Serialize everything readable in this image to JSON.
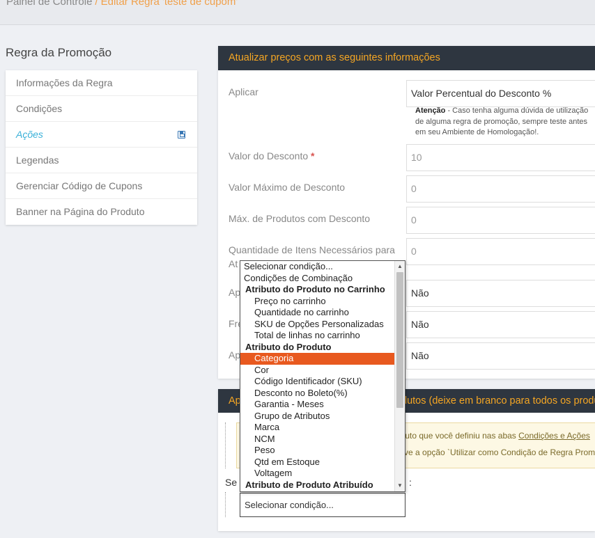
{
  "breadcrumb": {
    "root": "Painel de Controle",
    "separator": "/",
    "current": "Editar Regra 'teste de cupom'"
  },
  "sidebar": {
    "title": "Regra da Promoção",
    "items": [
      {
        "label": "Informações da Regra"
      },
      {
        "label": "Condições"
      },
      {
        "label": "Ações"
      },
      {
        "label": "Legendas"
      },
      {
        "label": "Gerenciar Código de Cupons"
      },
      {
        "label": "Banner na Página do Produto"
      }
    ]
  },
  "panel1": {
    "title": "Atualizar preços com as seguintes informações",
    "apply_label": "Aplicar",
    "apply_value": "Valor Percentual do Desconto %",
    "note_strong": "Atenção",
    "note_text": " - Caso tenha alguma dúvida de utilização de alguma regra de promoção, sempre teste antes em seu Ambiente de Homologação!.",
    "discount_label": "Valor do Desconto",
    "required_mark": "*",
    "discount_value": "10",
    "max_discount_label": "Valor Máximo de Desconto",
    "max_discount_value": "0",
    "max_products_label": "Máx. de Produtos com Desconto",
    "max_products_value": "0",
    "qty_label_line1": "Quantidade de Itens Necessários para",
    "qty_label_line2_prefix": "At",
    "qty_value": "0",
    "ap1_label_prefix": "Ap",
    "ap1_value": "Não",
    "fre_label_prefix": "Fre",
    "fre_value": "Não",
    "ap2_label_prefix": "Ap",
    "ap2_value": "Não"
  },
  "panel2": {
    "title_prefix": "Ap",
    "title_suffix": "dutos (deixe em branco para todos os produt",
    "info_line1": "oduto que você definiu nas abas ",
    "info_link": "Condições e Ações",
    "info_line2": "tive a opção `Utilizar como Condição de Regra Prom",
    "cond_prefix": "Se",
    "cond_suffix": ":",
    "cond_select_value": "Selecionar condição..."
  },
  "dropdown": {
    "options": [
      {
        "label": "Selecionar condição...",
        "kind": "top"
      },
      {
        "label": "Condições de Combinação",
        "kind": "top"
      },
      {
        "label": "Atributo do Produto no Carrinho",
        "kind": "group"
      },
      {
        "label": "Preço no carrinho",
        "kind": "child"
      },
      {
        "label": "Quantidade no carrinho",
        "kind": "child"
      },
      {
        "label": "SKU de Opções Personalizadas",
        "kind": "child"
      },
      {
        "label": "Total de linhas no carrinho",
        "kind": "child"
      },
      {
        "label": "Atributo do Produto",
        "kind": "group"
      },
      {
        "label": "Categoria",
        "kind": "child",
        "selected": true
      },
      {
        "label": "Cor",
        "kind": "child"
      },
      {
        "label": "Código Identificador (SKU)",
        "kind": "child"
      },
      {
        "label": "Desconto no Boleto(%)",
        "kind": "child"
      },
      {
        "label": "Garantia - Meses",
        "kind": "child"
      },
      {
        "label": "Grupo de Atributos",
        "kind": "child"
      },
      {
        "label": "Marca",
        "kind": "child"
      },
      {
        "label": "NCM",
        "kind": "child"
      },
      {
        "label": "Peso",
        "kind": "child"
      },
      {
        "label": "Qtd em Estoque",
        "kind": "child"
      },
      {
        "label": "Voltagem",
        "kind": "child"
      },
      {
        "label": "Atributo de Produto Atribuído",
        "kind": "group"
      }
    ]
  },
  "colors": {
    "accent_orange": "#f5a623",
    "selected_option": "#e8591f",
    "active_nav": "#39b0d8",
    "panel_header": "#2e3640"
  },
  "icons": {
    "active_item_icon": "save-icon"
  }
}
